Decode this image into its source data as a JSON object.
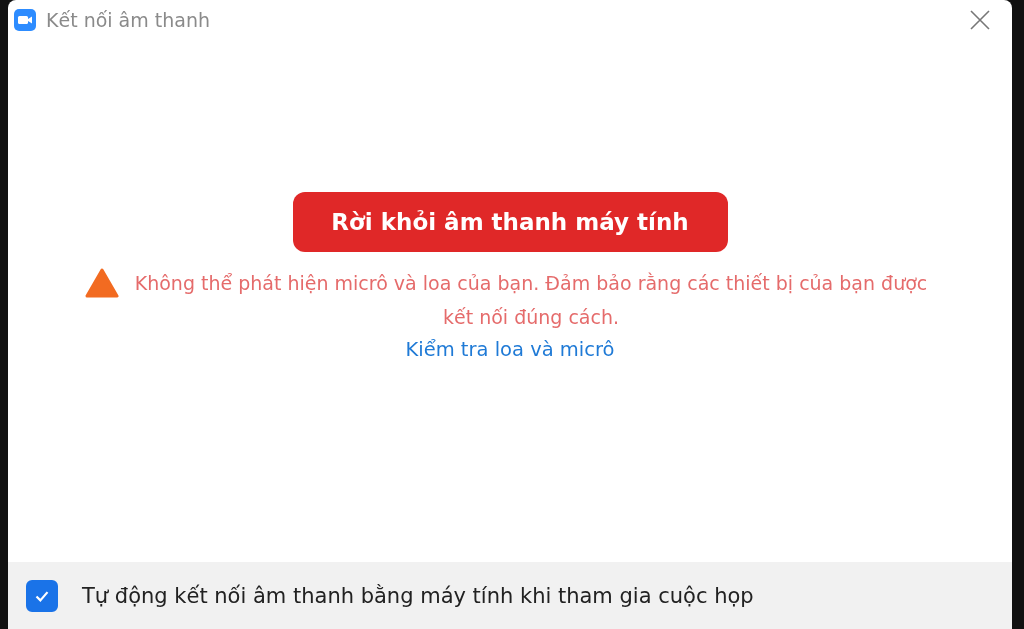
{
  "window": {
    "title": "Kết nối âm thanh"
  },
  "leave_button": {
    "label": "Rời khỏi âm thanh máy tính"
  },
  "warning": {
    "text": "Không thể phát hiện micrô và loa của bạn. Đảm bảo rằng các thiết bị của bạn được kết nối đúng cách."
  },
  "test_link": {
    "label": "Kiểm tra loa và micrô"
  },
  "auto_connect": {
    "label": "Tự động kết nối âm thanh bằng máy tính khi tham gia cuộc họp",
    "checked": true
  }
}
